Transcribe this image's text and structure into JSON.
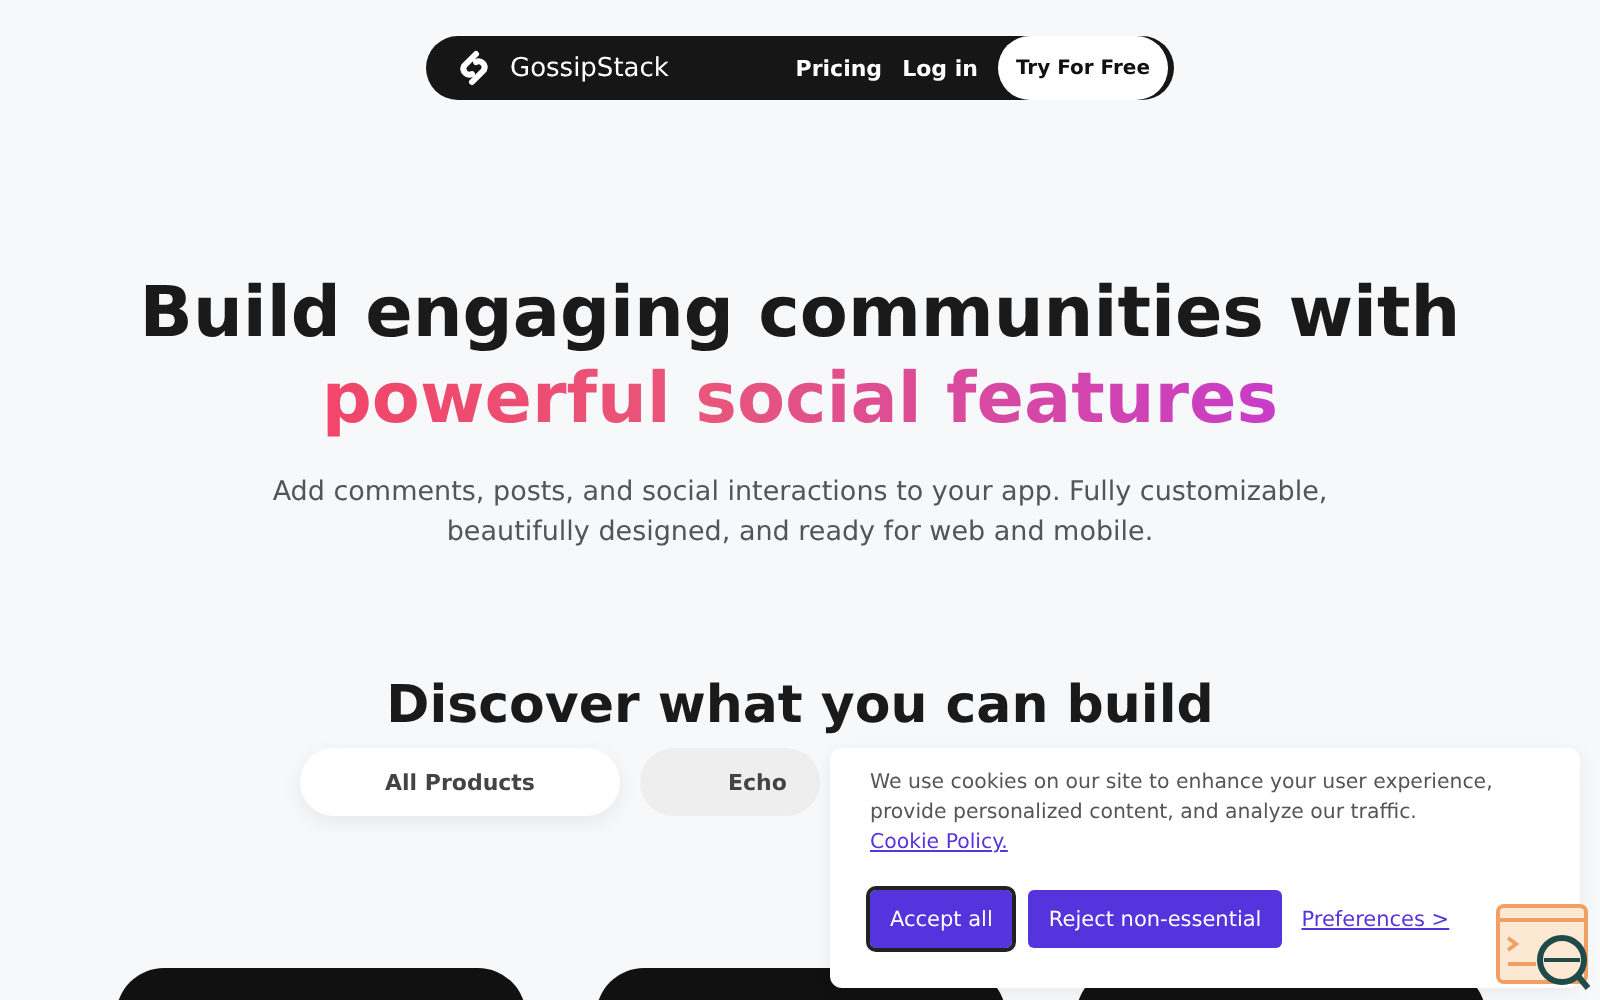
{
  "nav": {
    "brand": "GossipStack",
    "links": [
      {
        "label": "Pricing"
      },
      {
        "label": "Log in"
      }
    ],
    "cta": "Try For Free"
  },
  "hero": {
    "title": "Build engaging communities with",
    "highlight": "powerful social features",
    "subtitle": "Add comments, posts, and social interactions to your app. Fully customizable, beautifully designed, and ready for web and mobile."
  },
  "discover": {
    "title": "Discover what you can build",
    "tabs": [
      {
        "label": "All Products",
        "selected": true
      },
      {
        "label": "Echo",
        "selected": false
      }
    ]
  },
  "cookie_banner": {
    "text": "We use cookies on our site to enhance your user experience, provide personalized content, and analyze our traffic.",
    "policy_link": "Cookie Policy.",
    "buttons": [
      {
        "label": "Accept all",
        "focused": true
      },
      {
        "label": "Reject non-essential",
        "focused": false
      }
    ],
    "preferences": "Preferences >"
  }
}
